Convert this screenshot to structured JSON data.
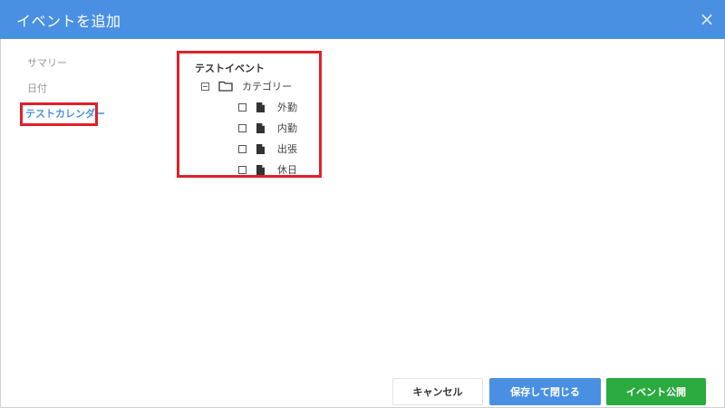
{
  "dialog": {
    "title": "イベントを追加",
    "close_label": "×"
  },
  "sidebar": {
    "items": [
      {
        "label": "サマリー",
        "active": false
      },
      {
        "label": "日付",
        "active": false
      },
      {
        "label": "テストカレンダー",
        "active": true
      }
    ]
  },
  "tree": {
    "title": "テストイベント",
    "folder": {
      "label": "カテゴリー",
      "icon": "folder-icon",
      "expanded": true
    },
    "items": [
      {
        "label": "外勤",
        "checked": false,
        "icon": "file-icon"
      },
      {
        "label": "内勤",
        "checked": false,
        "icon": "file-icon"
      },
      {
        "label": "出張",
        "checked": false,
        "icon": "file-icon"
      },
      {
        "label": "休日",
        "checked": false,
        "icon": "file-icon"
      }
    ]
  },
  "footer": {
    "cancel_label": "キャンセル",
    "save_label": "保存して閉じる",
    "publish_label": "イベント公開"
  },
  "colors": {
    "header": "#4a90e2",
    "highlight": "#e0202a",
    "primary": "#4a90e2",
    "success": "#2bab3f"
  }
}
